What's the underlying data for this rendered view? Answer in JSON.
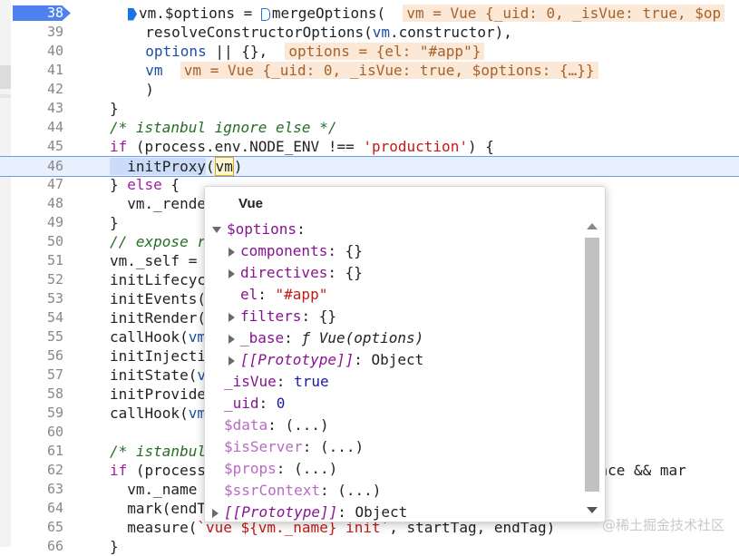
{
  "editor": {
    "lines": [
      {
        "n": "38",
        "tokens": [
          [
            "caret",
            ""
          ],
          [
            "prop",
            "vm.$options = "
          ],
          [
            "caret-h",
            ""
          ],
          [
            "prop",
            "mergeOptions(  "
          ],
          [
            "badge",
            "vm = Vue {_uid: 0, _isVue: true, $op"
          ]
        ]
      },
      {
        "n": "39",
        "tokens": [
          [
            "prop",
            "  resolveConstructorOptions("
          ],
          [
            "var",
            "vm"
          ],
          [
            "prop",
            ".constructor),"
          ]
        ]
      },
      {
        "n": "40",
        "tokens": [
          [
            "var",
            "  options"
          ],
          [
            "prop",
            " || {},  "
          ],
          [
            "badge",
            "options = {el: \"#app\"}"
          ]
        ]
      },
      {
        "n": "41",
        "tokens": [
          [
            "var",
            "  vm"
          ],
          [
            "prop",
            "  "
          ],
          [
            "badge",
            "vm = Vue {_uid: 0, _isVue: true, $options: {…}}"
          ]
        ]
      },
      {
        "n": "42",
        "tokens": [
          [
            "prop",
            "  )"
          ]
        ]
      },
      {
        "n": "43",
        "tokens": [
          [
            "prop",
            "}"
          ]
        ]
      },
      {
        "n": "44",
        "tokens": [
          [
            "cm",
            "/* istanbul ignore else */"
          ]
        ]
      },
      {
        "n": "45",
        "tokens": [
          [
            "kw",
            "if"
          ],
          [
            "prop",
            " (process.env.NODE_ENV !== "
          ],
          [
            "str",
            "'production'"
          ],
          [
            "prop",
            ") {"
          ]
        ]
      },
      {
        "n": "46",
        "tokens": [
          [
            "sel",
            "  initProxy"
          ],
          [
            "prop",
            "("
          ],
          [
            "hov",
            "vm"
          ],
          [
            "prop",
            ")"
          ]
        ]
      },
      {
        "n": "47",
        "tokens": [
          [
            "prop",
            "} "
          ],
          [
            "kw",
            "else"
          ],
          [
            "prop",
            " {"
          ]
        ]
      },
      {
        "n": "48",
        "tokens": [
          [
            "prop",
            "  vm._rende"
          ]
        ]
      },
      {
        "n": "49",
        "tokens": [
          [
            "prop",
            "}"
          ]
        ]
      },
      {
        "n": "50",
        "tokens": [
          [
            "cm",
            "// expose r"
          ]
        ]
      },
      {
        "n": "51",
        "tokens": [
          [
            "prop",
            "vm._self = "
          ]
        ]
      },
      {
        "n": "52",
        "tokens": [
          [
            "prop",
            "initLifecyc"
          ]
        ]
      },
      {
        "n": "53",
        "tokens": [
          [
            "prop",
            "initEvents("
          ]
        ]
      },
      {
        "n": "54",
        "tokens": [
          [
            "prop",
            "initRender("
          ]
        ]
      },
      {
        "n": "55",
        "tokens": [
          [
            "prop",
            "callHook("
          ],
          [
            "var",
            "vm"
          ]
        ]
      },
      {
        "n": "56",
        "tokens": [
          [
            "prop",
            "initInjecti"
          ],
          [
            "pad",
            "                                       "
          ],
          [
            "cm",
            "ps"
          ]
        ]
      },
      {
        "n": "57",
        "tokens": [
          [
            "prop",
            "initState("
          ],
          [
            "var",
            "v"
          ]
        ]
      },
      {
        "n": "58",
        "tokens": [
          [
            "prop",
            "initProvide"
          ]
        ]
      },
      {
        "n": "59",
        "tokens": [
          [
            "prop",
            "callHook("
          ],
          [
            "var",
            "vm"
          ]
        ]
      },
      {
        "n": "60",
        "tokens": []
      },
      {
        "n": "61",
        "tokens": [
          [
            "cm",
            "/* istanbul"
          ]
        ]
      },
      {
        "n": "62",
        "tokens": [
          [
            "kw",
            "if"
          ],
          [
            "prop",
            " (process"
          ],
          [
            "pad",
            "                                         "
          ],
          [
            "prop",
            "ormance && mar"
          ]
        ]
      },
      {
        "n": "63",
        "tokens": [
          [
            "prop",
            "  vm._name "
          ]
        ]
      },
      {
        "n": "64",
        "tokens": [
          [
            "prop",
            "  mark(endT"
          ]
        ]
      },
      {
        "n": "65",
        "tokens": [
          [
            "prop",
            "  measure("
          ],
          [
            "str",
            "`vue ${vm._name} init`"
          ],
          [
            "prop",
            ", startTag, endTag)"
          ]
        ]
      },
      {
        "n": "66",
        "tokens": [
          [
            "prop",
            "}"
          ]
        ]
      }
    ]
  },
  "popover": {
    "title": "Vue",
    "rows": [
      {
        "indent": 0,
        "arrow": "down",
        "key": "$options",
        "sep": ":",
        "value": "",
        "vtype": "obj",
        "keystyle": "k"
      },
      {
        "indent": 1,
        "arrow": "right",
        "key": "components",
        "sep": ": ",
        "value": "{}",
        "vtype": "obj",
        "keystyle": "k"
      },
      {
        "indent": 1,
        "arrow": "right",
        "key": "directives",
        "sep": ": ",
        "value": "{}",
        "vtype": "obj",
        "keystyle": "k"
      },
      {
        "indent": 1,
        "arrow": "",
        "key": "el",
        "sep": ": ",
        "value": "\"#app\"",
        "vtype": "str",
        "keystyle": "k"
      },
      {
        "indent": 1,
        "arrow": "right",
        "key": "filters",
        "sep": ": ",
        "value": "{}",
        "vtype": "obj",
        "keystyle": "k"
      },
      {
        "indent": 1,
        "arrow": "right",
        "key": "_base",
        "sep": ": ",
        "value": "ƒ Vue(options)",
        "vtype": "fn",
        "keystyle": "k"
      },
      {
        "indent": 1,
        "arrow": "right",
        "key": "[[Prototype]]",
        "sep": ": ",
        "value": "Object",
        "vtype": "obj",
        "keystyle": "k ital"
      },
      {
        "indent": 0,
        "arrow": "",
        "key": "_isVue",
        "sep": ": ",
        "value": "true",
        "vtype": "bool",
        "keystyle": "k"
      },
      {
        "indent": 0,
        "arrow": "",
        "key": "_uid",
        "sep": ": ",
        "value": "0",
        "vtype": "num",
        "keystyle": "k"
      },
      {
        "indent": 0,
        "arrow": "",
        "key": "$data",
        "sep": ": ",
        "value": "(...)",
        "vtype": "obj",
        "keystyle": "k dim"
      },
      {
        "indent": 0,
        "arrow": "",
        "key": "$isServer",
        "sep": ": ",
        "value": "(...)",
        "vtype": "obj",
        "keystyle": "k dim"
      },
      {
        "indent": 0,
        "arrow": "",
        "key": "$props",
        "sep": ": ",
        "value": "(...)",
        "vtype": "obj",
        "keystyle": "k dim"
      },
      {
        "indent": 0,
        "arrow": "",
        "key": "$ssrContext",
        "sep": ": ",
        "value": "(...)",
        "vtype": "obj",
        "keystyle": "k dim"
      },
      {
        "indent": 0,
        "arrow": "right",
        "key": "[[Prototype]]",
        "sep": ": ",
        "value": "Object",
        "vtype": "obj",
        "keystyle": "k ital"
      }
    ]
  },
  "watermark": "@稀土掘金技术社区"
}
